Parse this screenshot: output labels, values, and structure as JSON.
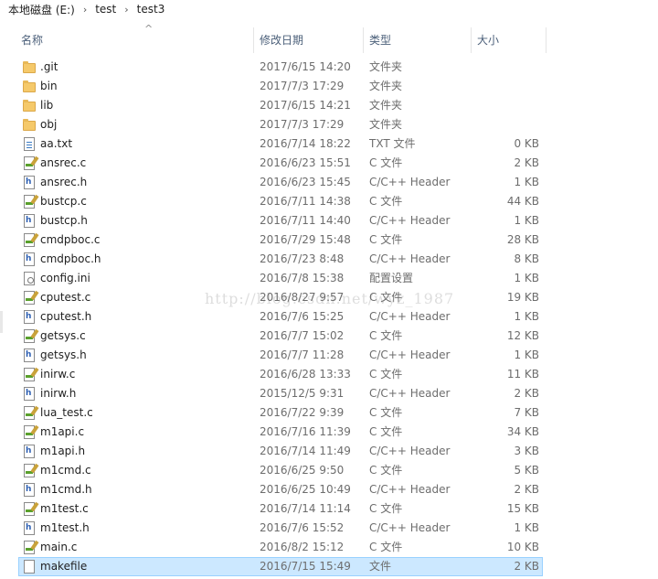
{
  "breadcrumb": [
    "本地磁盘 (E:)",
    "test",
    "test3"
  ],
  "columns": {
    "name": "名称",
    "date": "修改日期",
    "type": "类型",
    "size": "大小"
  },
  "sort_indicator": "^",
  "watermark": "http://blog.csdn.net/wyz_1987",
  "files": [
    {
      "icon": "folder",
      "name": ".git",
      "date": "2017/6/15 14:20",
      "type": "文件夹",
      "size": ""
    },
    {
      "icon": "folder",
      "name": "bin",
      "date": "2017/7/3 17:29",
      "type": "文件夹",
      "size": ""
    },
    {
      "icon": "folder",
      "name": "lib",
      "date": "2017/6/15 14:21",
      "type": "文件夹",
      "size": ""
    },
    {
      "icon": "folder",
      "name": "obj",
      "date": "2017/7/3 17:29",
      "type": "文件夹",
      "size": ""
    },
    {
      "icon": "txt",
      "name": "aa.txt",
      "date": "2016/7/14 18:22",
      "type": "TXT 文件",
      "size": "0 KB"
    },
    {
      "icon": "c",
      "name": "ansrec.c",
      "date": "2016/6/23 15:51",
      "type": "C 文件",
      "size": "2 KB"
    },
    {
      "icon": "h",
      "name": "ansrec.h",
      "date": "2016/6/23 15:45",
      "type": "C/C++ Header",
      "size": "1 KB"
    },
    {
      "icon": "c",
      "name": "bustcp.c",
      "date": "2016/7/11 14:38",
      "type": "C 文件",
      "size": "44 KB"
    },
    {
      "icon": "h",
      "name": "bustcp.h",
      "date": "2016/7/11 14:40",
      "type": "C/C++ Header",
      "size": "1 KB"
    },
    {
      "icon": "c",
      "name": "cmdpboc.c",
      "date": "2016/7/29 15:48",
      "type": "C 文件",
      "size": "28 KB"
    },
    {
      "icon": "h",
      "name": "cmdpboc.h",
      "date": "2016/7/23 8:48",
      "type": "C/C++ Header",
      "size": "8 KB"
    },
    {
      "icon": "ini",
      "name": "config.ini",
      "date": "2016/7/8 15:38",
      "type": "配置设置",
      "size": "1 KB"
    },
    {
      "icon": "c",
      "name": "cputest.c",
      "date": "2016/8/27 9:57",
      "type": "C 文件",
      "size": "19 KB"
    },
    {
      "icon": "h",
      "name": "cputest.h",
      "date": "2016/7/6 15:25",
      "type": "C/C++ Header",
      "size": "1 KB"
    },
    {
      "icon": "c",
      "name": "getsys.c",
      "date": "2016/7/7 15:02",
      "type": "C 文件",
      "size": "12 KB"
    },
    {
      "icon": "h",
      "name": "getsys.h",
      "date": "2016/7/7 11:28",
      "type": "C/C++ Header",
      "size": "1 KB"
    },
    {
      "icon": "c",
      "name": "inirw.c",
      "date": "2016/6/28 13:33",
      "type": "C 文件",
      "size": "11 KB"
    },
    {
      "icon": "h",
      "name": "inirw.h",
      "date": "2015/12/5 9:31",
      "type": "C/C++ Header",
      "size": "2 KB"
    },
    {
      "icon": "c",
      "name": "lua_test.c",
      "date": "2016/7/22 9:39",
      "type": "C 文件",
      "size": "7 KB"
    },
    {
      "icon": "c",
      "name": "m1api.c",
      "date": "2016/7/16 11:39",
      "type": "C 文件",
      "size": "34 KB"
    },
    {
      "icon": "h",
      "name": "m1api.h",
      "date": "2016/7/14 11:49",
      "type": "C/C++ Header",
      "size": "3 KB"
    },
    {
      "icon": "c",
      "name": "m1cmd.c",
      "date": "2016/6/25 9:50",
      "type": "C 文件",
      "size": "5 KB"
    },
    {
      "icon": "h",
      "name": "m1cmd.h",
      "date": "2016/6/25 10:49",
      "type": "C/C++ Header",
      "size": "2 KB"
    },
    {
      "icon": "c",
      "name": "m1test.c",
      "date": "2016/7/14 11:14",
      "type": "C 文件",
      "size": "15 KB"
    },
    {
      "icon": "h",
      "name": "m1test.h",
      "date": "2016/7/6 15:52",
      "type": "C/C++ Header",
      "size": "1 KB"
    },
    {
      "icon": "c",
      "name": "main.c",
      "date": "2016/8/2 15:12",
      "type": "C 文件",
      "size": "10 KB"
    },
    {
      "icon": "doc",
      "name": "makefile",
      "date": "2016/7/15 15:49",
      "type": "文件",
      "size": "2 KB",
      "selected": true
    }
  ]
}
